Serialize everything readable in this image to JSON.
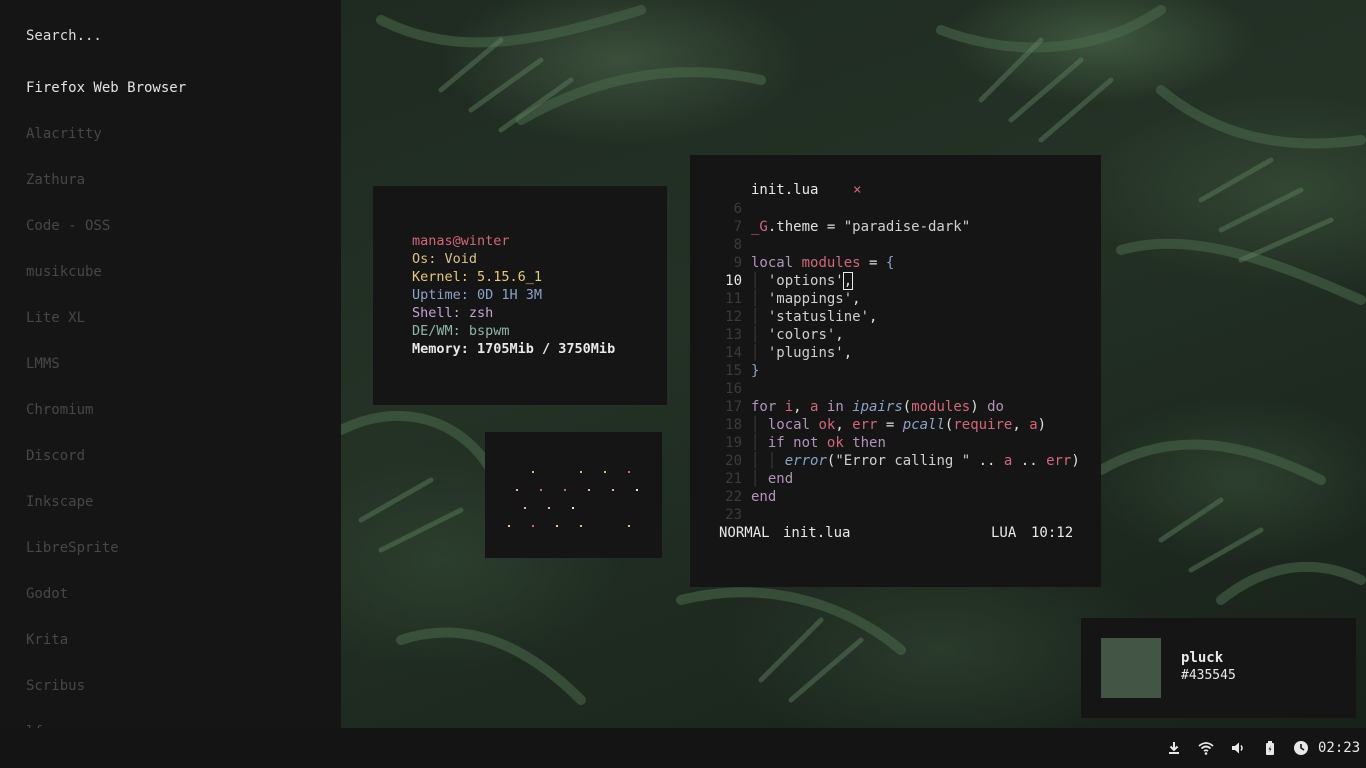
{
  "launcher": {
    "search_placeholder": "Search...",
    "apps": [
      {
        "label": "Firefox Web Browser",
        "selected": true
      },
      {
        "label": "Alacritty"
      },
      {
        "label": "Zathura"
      },
      {
        "label": "Code - OSS"
      },
      {
        "label": "musikcube"
      },
      {
        "label": "Lite XL"
      },
      {
        "label": "LMMS"
      },
      {
        "label": "Chromium"
      },
      {
        "label": "Discord"
      },
      {
        "label": "Inkscape"
      },
      {
        "label": "LibreSprite"
      },
      {
        "label": "Godot"
      },
      {
        "label": "Krita"
      },
      {
        "label": "Scribus"
      },
      {
        "label": "lf"
      }
    ]
  },
  "fetch": {
    "user_host": "manas@winter",
    "os": "Os: Void",
    "kernel": "Kernel: 5.15.6_1",
    "uptime": "Uptime: 0D 1H 3M",
    "shell": "Shell: zsh",
    "wm": "DE/WM: bspwm",
    "memory": "Memory: 1705Mib / 3750Mib",
    "colors": {
      "user_host": "#d0677a",
      "os": "#d8c08a",
      "kernel": "#e8c87a",
      "uptime": "#8aa3c7",
      "shell": "#c3a3d6",
      "wm": "#8fb5a8",
      "memory": "#e8e8e8"
    }
  },
  "editor": {
    "tab_title": "init.lua",
    "close_glyph": "×",
    "current_line": "10",
    "lines": [
      {
        "n": "6",
        "code": ""
      },
      {
        "n": "7",
        "code": "_G.theme = \"paradise-dark\""
      },
      {
        "n": "8",
        "code": ""
      },
      {
        "n": "9",
        "code": "local modules = {"
      },
      {
        "n": "10",
        "code": "  'options',"
      },
      {
        "n": "11",
        "code": "  'mappings',"
      },
      {
        "n": "12",
        "code": "  'statusline',"
      },
      {
        "n": "13",
        "code": "  'colors',"
      },
      {
        "n": "14",
        "code": "  'plugins',"
      },
      {
        "n": "15",
        "code": "}"
      },
      {
        "n": "16",
        "code": ""
      },
      {
        "n": "17",
        "code": "for i, a in ipairs(modules) do"
      },
      {
        "n": "18",
        "code": "  local ok, err = pcall(require, a)"
      },
      {
        "n": "19",
        "code": "  if not ok then"
      },
      {
        "n": "20",
        "code": "  │ error(\"Error calling \" .. a .. err)"
      },
      {
        "n": "21",
        "code": "  end"
      },
      {
        "n": "22",
        "code": "end"
      },
      {
        "n": "23",
        "code": ""
      }
    ],
    "statusline": {
      "mode": "NORMAL",
      "file": "init.lua",
      "lang": "LUA",
      "position": "10:12"
    }
  },
  "color_card": {
    "name": "pluck",
    "hex": "#435545"
  },
  "bar": {
    "icons": [
      "download-icon",
      "wifi-icon",
      "volume-icon",
      "battery-icon",
      "clock-icon"
    ],
    "time": "02:23"
  }
}
